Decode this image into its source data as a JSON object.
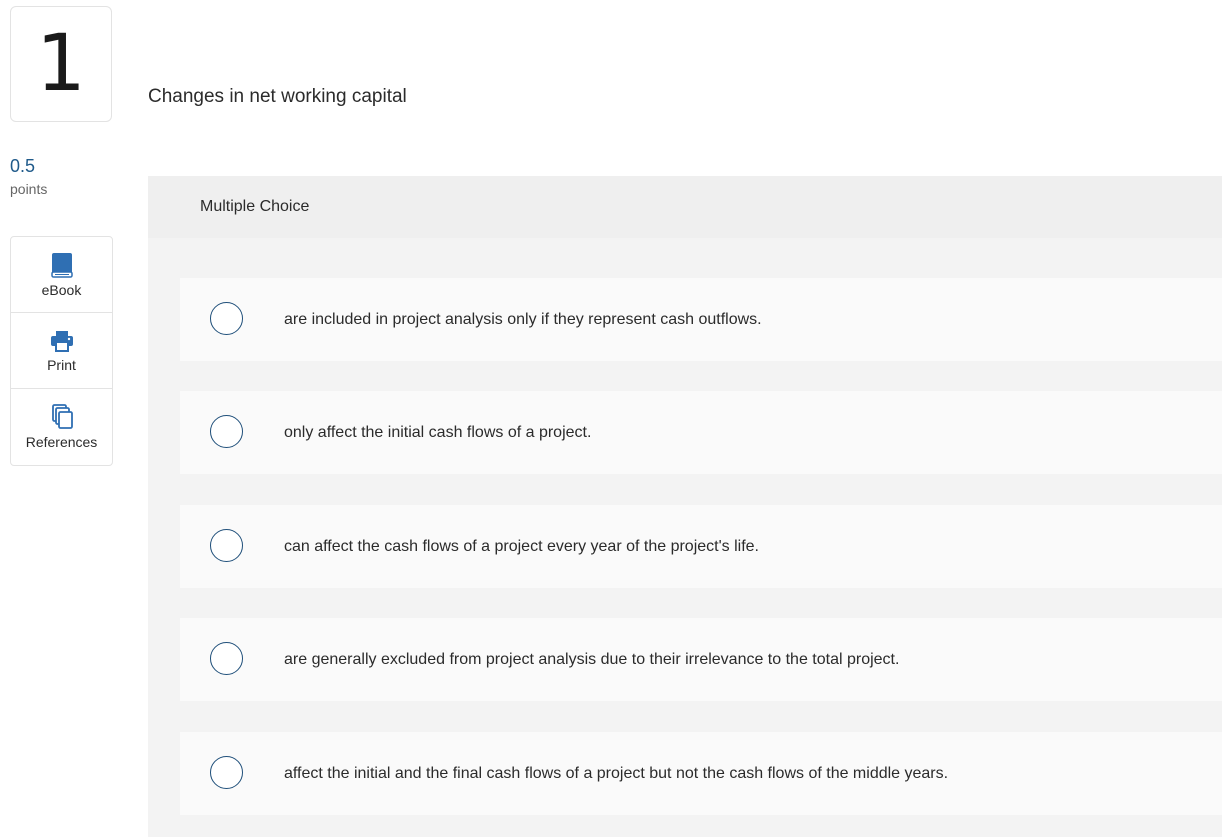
{
  "question": {
    "number": "1",
    "points_value": "0.5",
    "points_label": "points",
    "title": "Changes in net working capital",
    "type_label": "Multiple Choice"
  },
  "tools": [
    {
      "label": "eBook",
      "icon": "book-icon",
      "color": "#2f6fb3"
    },
    {
      "label": "Print",
      "icon": "printer-icon",
      "color": "#2f6fb3"
    },
    {
      "label": "References",
      "icon": "copy-documents-icon",
      "color": "#2f6fb3"
    }
  ],
  "choices": [
    "are included in project analysis only if they represent cash outflows.",
    "only affect the initial cash flows of a project.",
    "can affect the cash flows of a project every year of the project's life.",
    "are generally excluded from project analysis due to their irrelevance to the total project.",
    "affect the initial and the final cash flows of a project but not the cash flows of the middle years."
  ],
  "colors": {
    "accent": "#1f4f7a",
    "panel_bg": "#f3f3f3",
    "choice_bg": "#fafafa"
  }
}
